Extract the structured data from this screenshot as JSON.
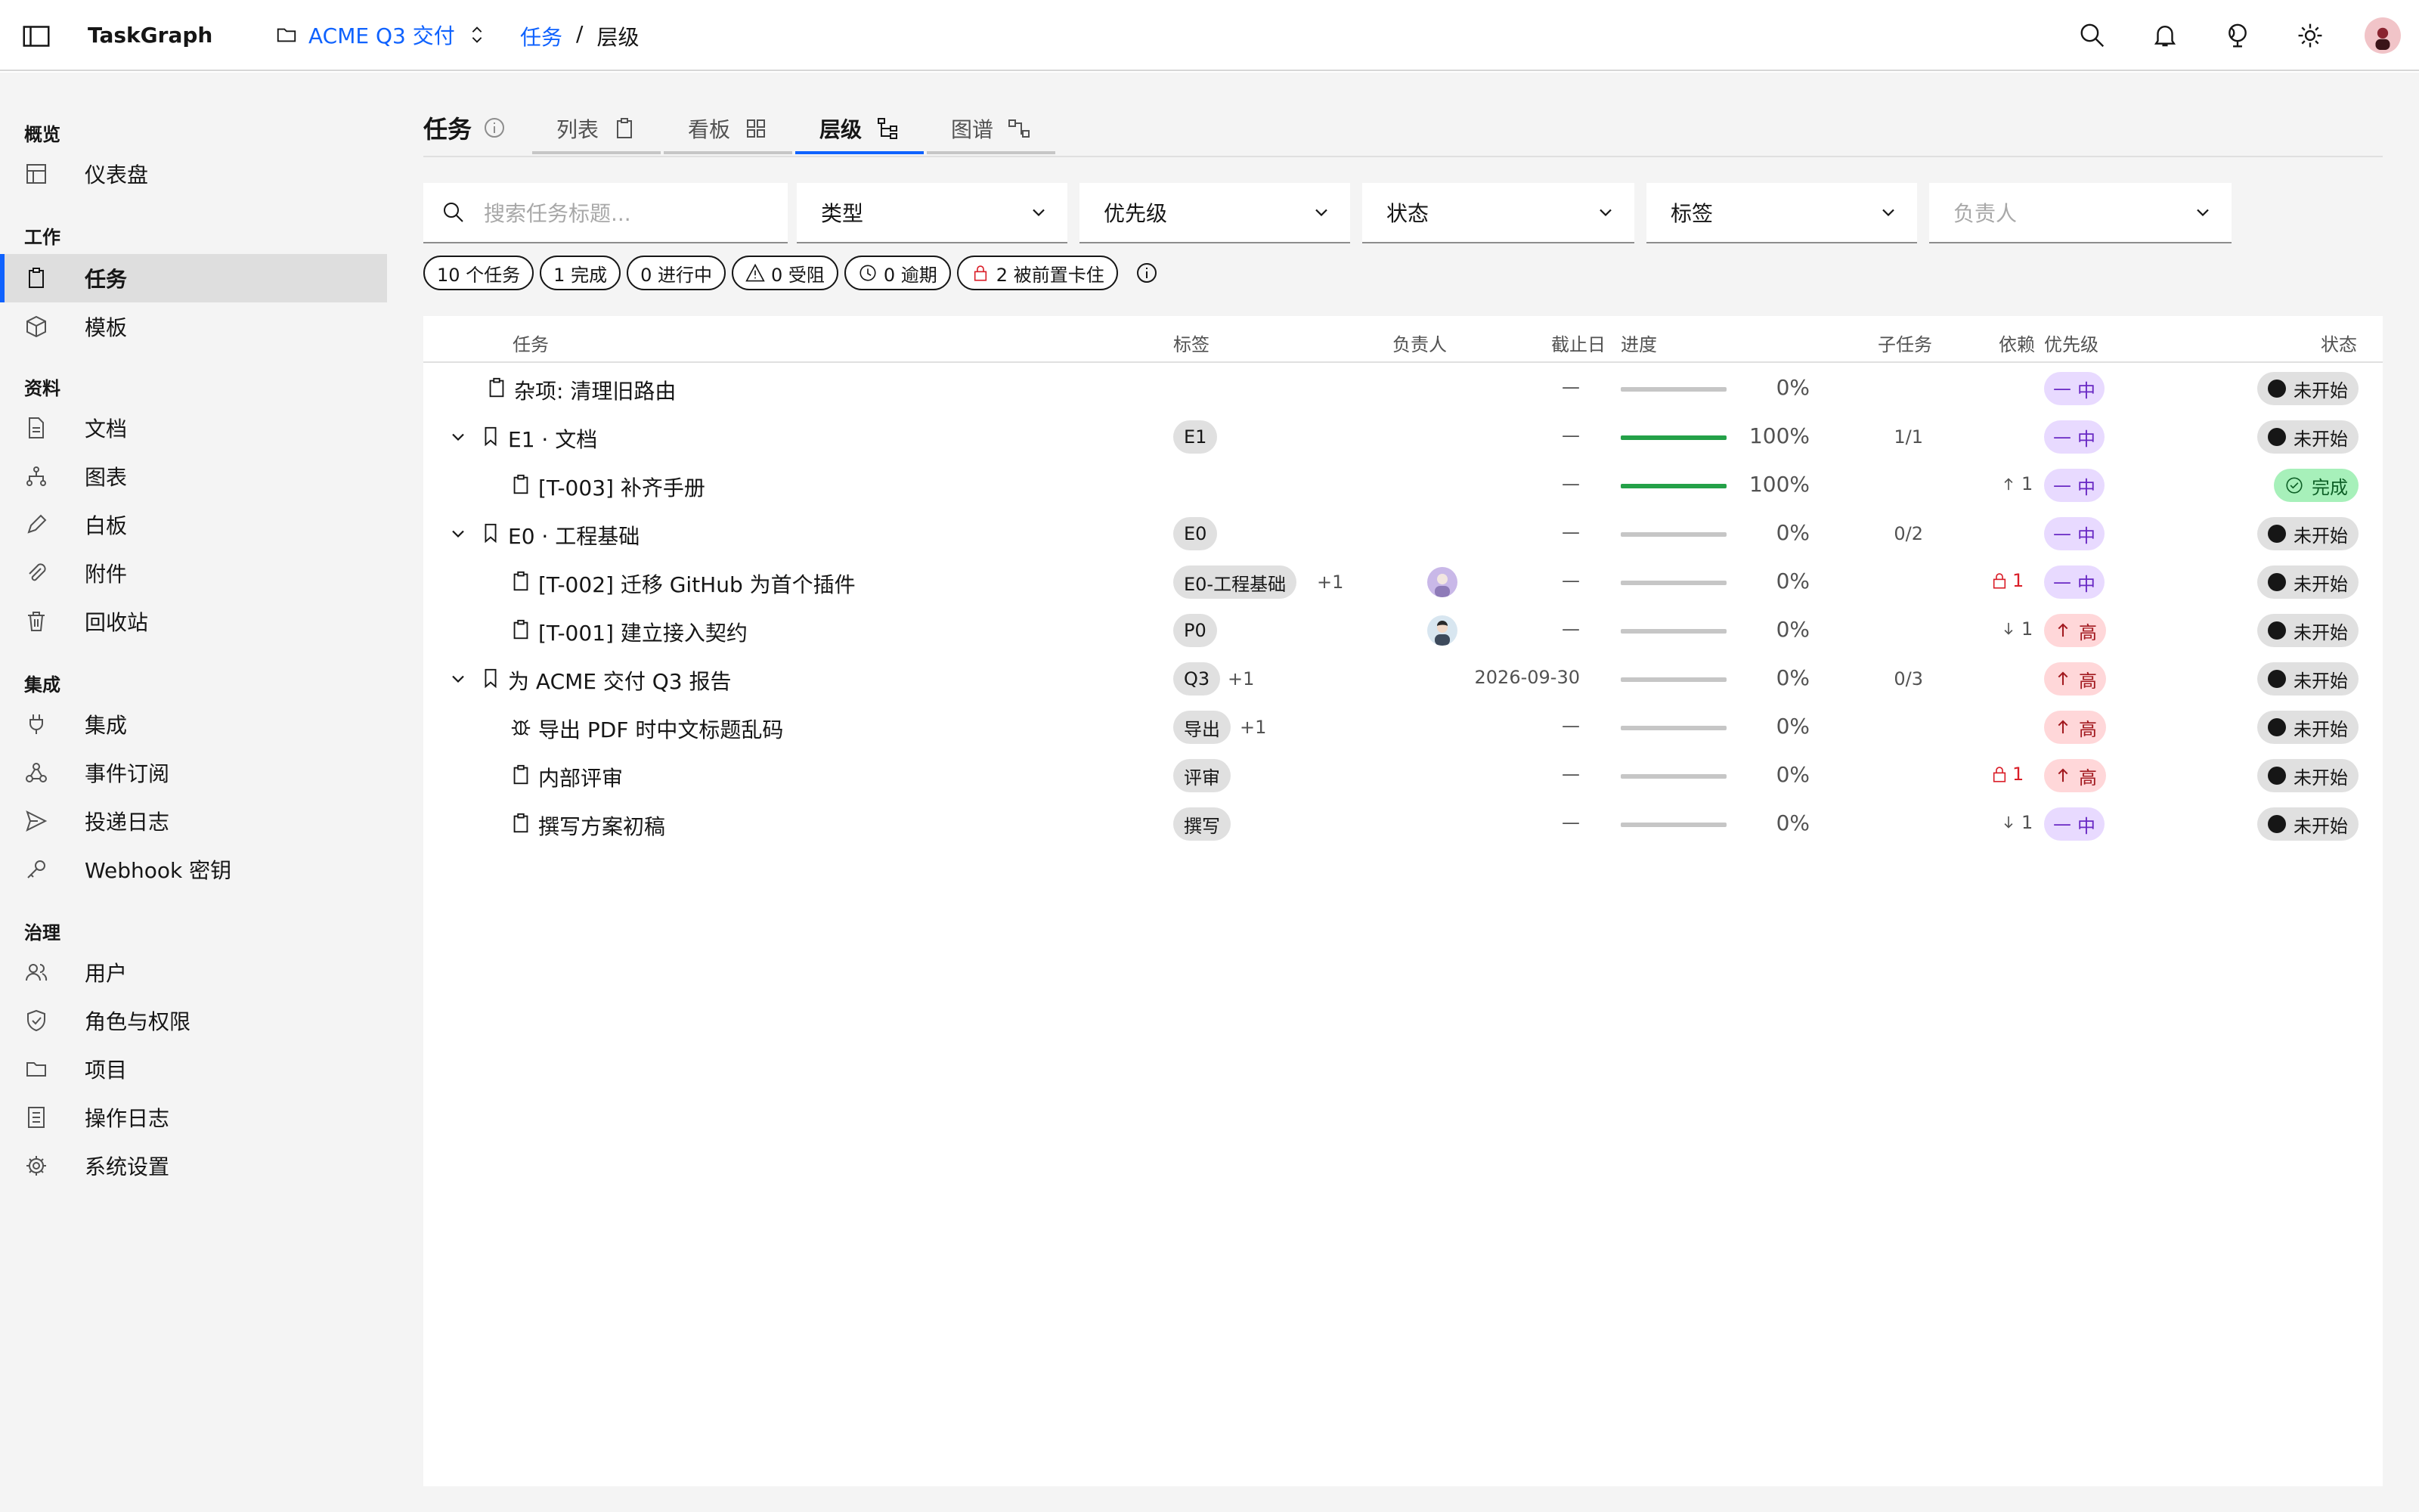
{
  "header": {
    "brand": "TaskGraph",
    "project": "ACME Q3 交付",
    "breadcrumb_link": "任务",
    "breadcrumb_sep": "/",
    "breadcrumb_current": "层级"
  },
  "sidebar": {
    "groups": {
      "overview": "概览",
      "work": "工作",
      "resources": "资料",
      "integration": "集成",
      "governance": "治理"
    },
    "items": {
      "dashboard": "仪表盘",
      "tasks": "任务",
      "templates": "模板",
      "docs": "文档",
      "charts": "图表",
      "whiteboard": "白板",
      "attachments": "附件",
      "trash": "回收站",
      "integrations": "集成",
      "event_subscriptions": "事件订阅",
      "delivery_log": "投递日志",
      "webhook_keys": "Webhook 密钥",
      "users": "用户",
      "roles": "角色与权限",
      "projects": "项目",
      "audit_log": "操作日志",
      "system_settings": "系统设置"
    }
  },
  "page": {
    "title": "任务",
    "tabs": {
      "list": "列表",
      "board": "看板",
      "hierarchy": "层级",
      "graph": "图谱"
    }
  },
  "filters": {
    "search_placeholder": "搜索任务标题...",
    "type": "类型",
    "priority": "优先级",
    "status": "状态",
    "tags": "标签",
    "assignee": "负责人"
  },
  "stats": {
    "tasks": "10 个任务",
    "done": "1 完成",
    "in_progress": "0 进行中",
    "blocked": "0 受阻",
    "overdue": "0 逾期",
    "prereq_blocked": "2 被前置卡住"
  },
  "table": {
    "headers": {
      "task": "任务",
      "tags": "标签",
      "assignee": "负责人",
      "due": "截止日",
      "progress": "进度",
      "subtasks": "子任务",
      "deps": "依赖",
      "priority": "优先级",
      "status": "状态"
    },
    "rows": [
      {
        "title": "杂项:  清理旧路由",
        "due": "—",
        "progress": 0,
        "progress_label": "0%",
        "priority": "中",
        "status": "未开始"
      },
      {
        "title": "E1 · 文档",
        "tag": "E1",
        "due": "—",
        "progress": 100,
        "progress_label": "100%",
        "subtasks": "1/1",
        "priority": "中",
        "status": "未开始"
      },
      {
        "title": "[T-003] 补齐手册",
        "due": "—",
        "progress": 100,
        "progress_label": "100%",
        "deps": "1",
        "priority": "中",
        "status": "完成"
      },
      {
        "title": "E0 · 工程基础",
        "tag": "E0",
        "due": "—",
        "progress": 0,
        "progress_label": "0%",
        "subtasks": "0/2",
        "priority": "中",
        "status": "未开始"
      },
      {
        "title": "[T-002] 迁移 GitHub 为首个插件",
        "tag": "E0-工程基础",
        "tag_more": "+1",
        "due": "—",
        "progress": 0,
        "progress_label": "0%",
        "deps": "1",
        "priority": "中",
        "status": "未开始"
      },
      {
        "title": "[T-001] 建立接入契约",
        "tag": "P0",
        "due": "—",
        "progress": 0,
        "progress_label": "0%",
        "deps": "1",
        "priority": "高",
        "status": "未开始"
      },
      {
        "title": "为 ACME 交付 Q3 报告",
        "tag": "Q3",
        "tag_more": "+1",
        "due": "2026-09-30",
        "progress": 0,
        "progress_label": "0%",
        "subtasks": "0/3",
        "priority": "高",
        "status": "未开始"
      },
      {
        "title": "导出 PDF 时中文标题乱码",
        "tag": "导出",
        "tag_more": "+1",
        "due": "—",
        "progress": 0,
        "progress_label": "0%",
        "priority": "高",
        "status": "未开始"
      },
      {
        "title": "内部评审",
        "tag": "评审",
        "due": "—",
        "progress": 0,
        "progress_label": "0%",
        "deps": "1",
        "priority": "高",
        "status": "未开始"
      },
      {
        "title": "撰写方案初稿",
        "tag": "撰写",
        "due": "—",
        "progress": 0,
        "progress_label": "0%",
        "deps": "1",
        "priority": "中",
        "status": "未开始"
      }
    ]
  },
  "colors": {
    "accent": "#0f62fe",
    "progress_fill": "#24a148",
    "priority_mid_bg": "#e8daff",
    "priority_high_bg": "#ffd7d9",
    "status_done_bg": "#a7f0ba"
  }
}
